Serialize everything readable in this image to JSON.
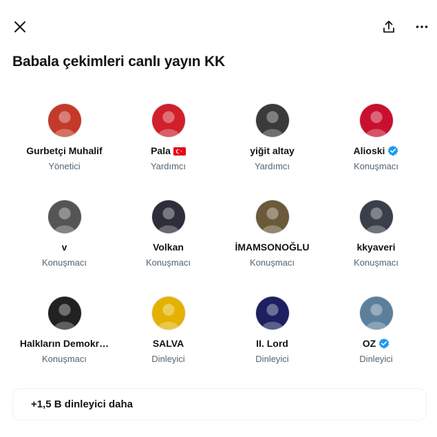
{
  "header": {
    "close_icon": "close-icon",
    "share_icon": "share-icon",
    "more_icon": "more-options-icon"
  },
  "space": {
    "title": "Babala çekimleri canlı yayın KK"
  },
  "participants": [
    {
      "name": "Gurbetçi Muhalif",
      "role": "Yönetici",
      "verified": false,
      "flag": false,
      "avatar_color": "#c43a2a"
    },
    {
      "name": "Pala",
      "role": "Yardımcı",
      "verified": false,
      "flag": true,
      "avatar_color": "#d0202c"
    },
    {
      "name": "yiğit altay",
      "role": "Yardımcı",
      "verified": false,
      "flag": false,
      "avatar_color": "#3a3a3a"
    },
    {
      "name": "Alioski",
      "role": "Konuşmacı",
      "verified": true,
      "flag": false,
      "avatar_color": "#c8102e"
    },
    {
      "name": "v",
      "role": "Konuşmacı",
      "verified": false,
      "flag": false,
      "avatar_color": "#555555"
    },
    {
      "name": "Volkan",
      "role": "Konuşmacı",
      "verified": false,
      "flag": false,
      "avatar_color": "#2e2e3a"
    },
    {
      "name": "İMAMSONOĞLU",
      "role": "Konuşmacı",
      "verified": false,
      "flag": false,
      "avatar_color": "#6b5a3a"
    },
    {
      "name": "kkyaveri",
      "role": "Konuşmacı",
      "verified": false,
      "flag": false,
      "avatar_color": "#3b3f4a"
    },
    {
      "name": "Halkların Demokr…",
      "role": "Konuşmacı",
      "verified": false,
      "flag": false,
      "avatar_color": "#222222"
    },
    {
      "name": "SALVA",
      "role": "Dinleyici",
      "verified": false,
      "flag": false,
      "avatar_color": "#e3b200"
    },
    {
      "name": "II. Lord",
      "role": "Dinleyici",
      "verified": false,
      "flag": false,
      "avatar_color": "#1c2060"
    },
    {
      "name": "OZ",
      "role": "Dinleyici",
      "verified": true,
      "flag": false,
      "avatar_color": "#5c7f9c"
    }
  ],
  "footer": {
    "more_listeners": "+1,5 B dinleyici daha"
  },
  "colors": {
    "verified_blue": "#1d9bf0",
    "text_primary": "#0f1419",
    "text_secondary": "#536471",
    "turkey_red": "#e30a17"
  }
}
